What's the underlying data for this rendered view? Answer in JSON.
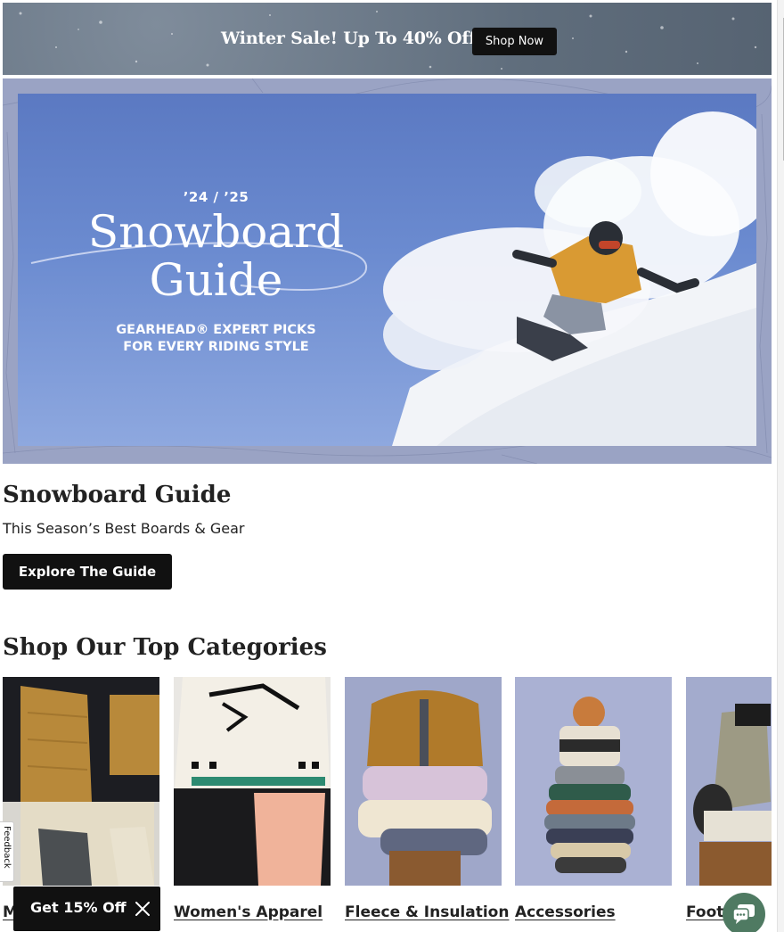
{
  "promo": {
    "text": "Winter Sale! Up To 40% Off",
    "button_label": "Shop Now"
  },
  "hero": {
    "season": "’24 / ’25",
    "title_line1": "Snowboard",
    "title_line2": "Guide",
    "subtitle": "GEARHEAD® EXPERT PICKS\nFOR EVERY RIDING STYLE"
  },
  "guide": {
    "title": "Snowboard Guide",
    "subtitle": "This Season’s Best Boards & Gear",
    "button_label": "Explore The Guide"
  },
  "categories": {
    "heading": "Shop Our Top Categories",
    "items": [
      {
        "label": "M"
      },
      {
        "label": "Women's Apparel"
      },
      {
        "label": "Fleece & Insulation"
      },
      {
        "label": "Accessories"
      },
      {
        "label": "Footw"
      }
    ]
  },
  "feedback": {
    "label": "Feedback"
  },
  "discount": {
    "label": "Get 15% Off"
  },
  "icons": {
    "close": "close-icon",
    "chat": "chat-icon"
  },
  "colors": {
    "primary_button": "#111111",
    "chat_bubble": "#4f7a62",
    "hero_frame": "#9aa3c4"
  }
}
